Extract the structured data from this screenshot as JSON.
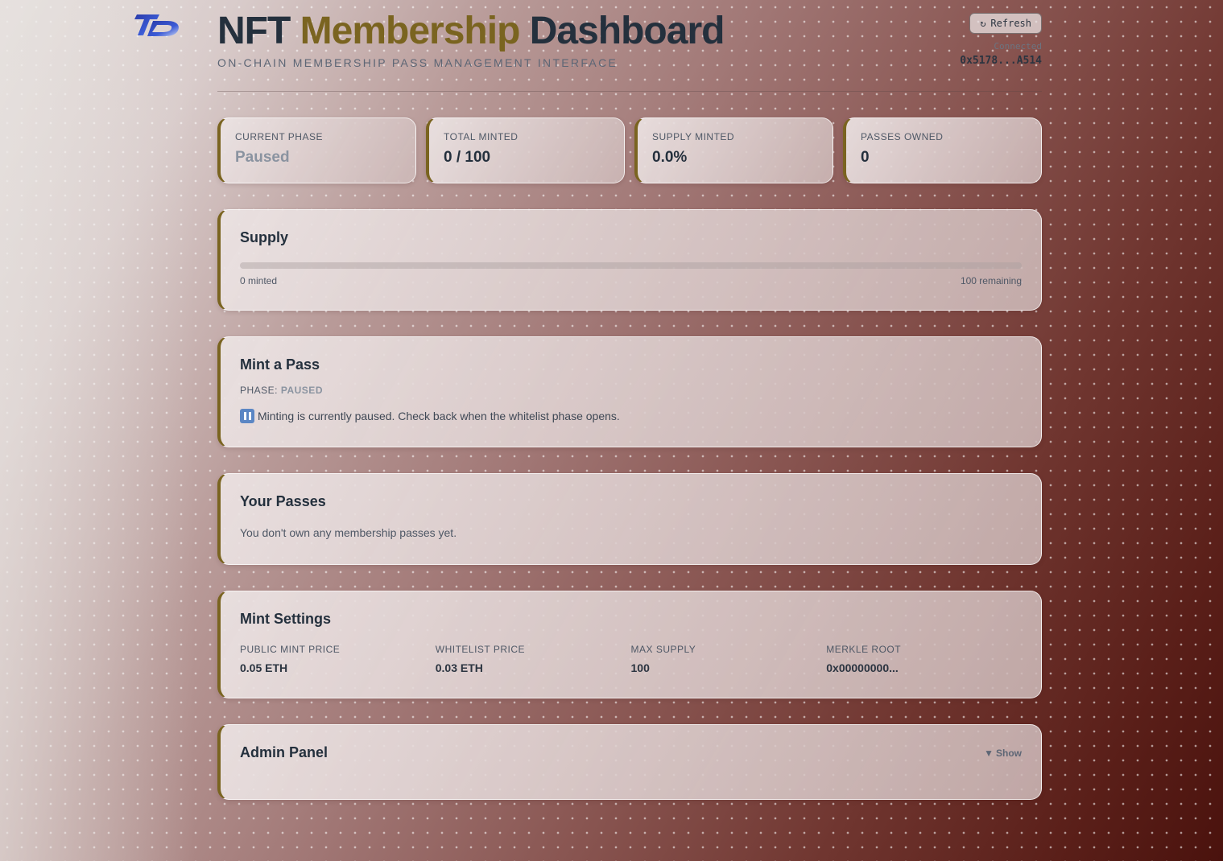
{
  "header": {
    "title_part1": "NFT",
    "title_part2": "Membership",
    "title_part3": "Dashboard",
    "subtitle": "ON-CHAIN MEMBERSHIP PASS MANAGEMENT INTERFACE",
    "refresh_label": "Refresh",
    "connected_label": "Connected",
    "address": "0x5178...A514",
    "accent_color": "#7a6420"
  },
  "stats": [
    {
      "label": "CURRENT PHASE",
      "value": "Paused"
    },
    {
      "label": "TOTAL MINTED",
      "value": "0 / 100"
    },
    {
      "label": "SUPPLY MINTED",
      "value": "0.0%"
    },
    {
      "label": "PASSES OWNED",
      "value": "0"
    }
  ],
  "supply": {
    "title": "Supply",
    "progress": 0,
    "minted_label": "0 minted",
    "remaining_label": "100 remaining"
  },
  "mint": {
    "title": "Mint a Pass",
    "phase_label": "PHASE:",
    "phase_value": "PAUSED",
    "notice": "Minting is currently paused. Check back when the whitelist phase opens."
  },
  "passes": {
    "title": "Your Passes",
    "empty_text": "You don't own any membership passes yet."
  },
  "settings": {
    "title": "Mint Settings",
    "items": [
      {
        "label": "PUBLIC MINT PRICE",
        "value": "0.05 ETH"
      },
      {
        "label": "WHITELIST PRICE",
        "value": "0.03 ETH"
      },
      {
        "label": "MAX SUPPLY",
        "value": "100"
      },
      {
        "label": "MERKLE ROOT",
        "value": "0x00000000..."
      }
    ]
  },
  "admin": {
    "title": "Admin Panel",
    "toggle_label": "Show"
  }
}
